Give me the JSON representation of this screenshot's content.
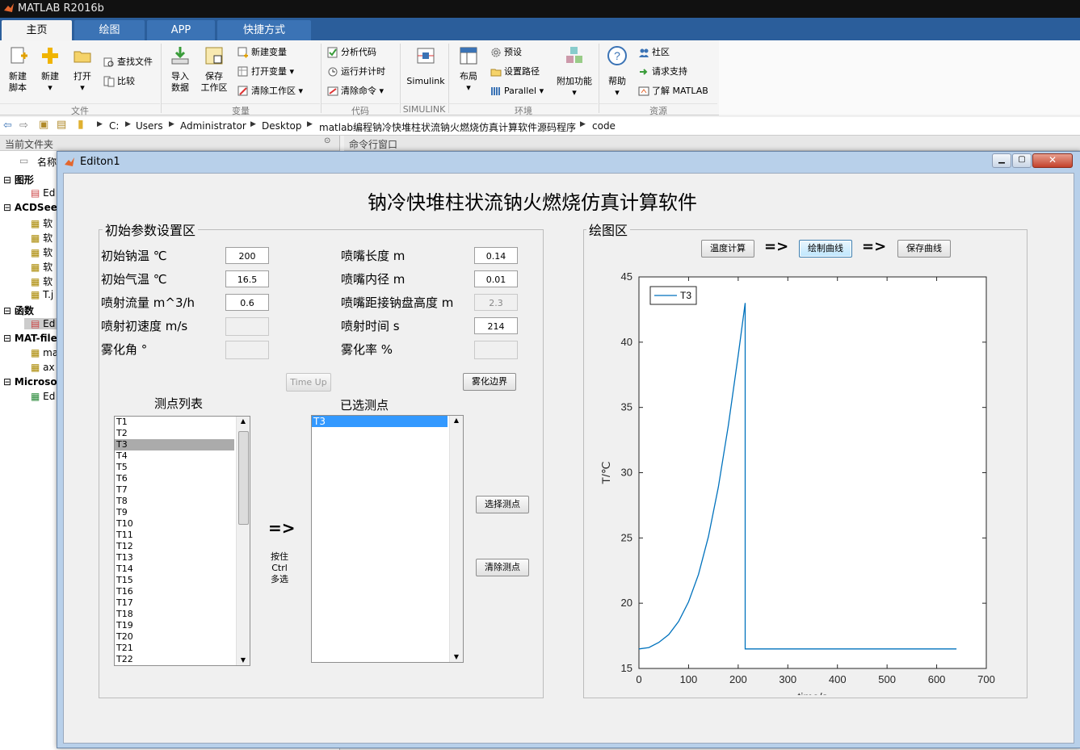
{
  "app": {
    "title": "MATLAB R2016b"
  },
  "tabs": [
    "主页",
    "绘图",
    "APP",
    "快捷方式"
  ],
  "ribbon": {
    "file": {
      "section": "文件",
      "new_script": [
        "新建",
        "脚本"
      ],
      "new": "新建",
      "open": "打开",
      "find_files": "查找文件",
      "compare": "比较"
    },
    "variable": {
      "section": "变量",
      "import": [
        "导入",
        "数据"
      ],
      "save": [
        "保存",
        "工作区"
      ],
      "new_variable": "新建变量",
      "open_variable": "打开变量",
      "clear_workspace": "清除工作区"
    },
    "code": {
      "section": "代码",
      "analyze": "分析代码",
      "run_time": "运行并计时",
      "clear_commands": "清除命令"
    },
    "simulink": {
      "section": "SIMULINK",
      "label": "Simulink"
    },
    "environment": {
      "section": "环境",
      "layout": "布局",
      "preferences": "预设",
      "set_path": "设置路径",
      "parallel": "Parallel",
      "addons": "附加功能"
    },
    "resources": {
      "section": "资源",
      "help": "帮助",
      "community": "社区",
      "support": "请求支持",
      "learn": "了解 MATLAB"
    }
  },
  "address": [
    "C:",
    "Users",
    "Administrator",
    "Desktop",
    "matlab编程钠冷快堆柱状流钠火燃烧仿真计算软件源码程序",
    "code"
  ],
  "current_folder": {
    "header": "当前文件夹",
    "name_col": "名称",
    "groups": [
      {
        "label": "图形",
        "items": [
          "Ed"
        ]
      },
      {
        "label": "ACDSee",
        "items": [
          "软",
          "软",
          "软",
          "软",
          "软",
          "T.j"
        ]
      },
      {
        "label": "函数",
        "items": [
          "Ed"
        ]
      },
      {
        "label": "MAT-file",
        "items": [
          "ma",
          "ax"
        ]
      },
      {
        "label": "Microsof",
        "items": [
          "Ed"
        ]
      }
    ]
  },
  "command_window": {
    "header": "命令行窗口"
  },
  "figure": {
    "window_title": "Editon1",
    "main_title": "钠冷快堆柱状流钠火燃烧仿真计算软件",
    "params_panel": {
      "title": "初始参数设置区",
      "left": [
        {
          "label": "初始钠温 ℃",
          "value": "200",
          "enabled": true
        },
        {
          "label": "初始气温 ℃",
          "value": "16.5",
          "enabled": true
        },
        {
          "label": "喷射流量 m^3/h",
          "value": "0.6",
          "enabled": true
        },
        {
          "label": "喷射初速度 m/s",
          "value": "",
          "enabled": false
        },
        {
          "label": "雾化角 °",
          "value": "",
          "enabled": false
        }
      ],
      "right": [
        {
          "label": "喷嘴长度 m",
          "value": "0.14",
          "enabled": true
        },
        {
          "label": "喷嘴内径 m",
          "value": "0.01",
          "enabled": true
        },
        {
          "label": "喷嘴距接钠盘高度 m",
          "value": "2.3",
          "enabled": false
        },
        {
          "label": "喷射时间 s",
          "value": "214",
          "enabled": true
        },
        {
          "label": "雾化率 %",
          "value": "",
          "enabled": false
        }
      ],
      "time_up": "Time Up",
      "atomize_boundary": "雾化边界",
      "point_list_title": "测点列表",
      "point_list": [
        "T1",
        "T2",
        "T3",
        "T4",
        "T5",
        "T6",
        "T7",
        "T8",
        "T9",
        "T10",
        "T11",
        "T12",
        "T13",
        "T14",
        "T15",
        "T16",
        "T17",
        "T18",
        "T19",
        "T20",
        "T21",
        "T22"
      ],
      "point_list_selected": "T3",
      "arrow": "=>",
      "multi_note": [
        "按住",
        "Ctrl",
        "多选"
      ],
      "selected_title": "已选测点",
      "selected_points": [
        "T3"
      ],
      "select_button": "选择测点",
      "clear_button": "清除测点"
    },
    "plot_panel": {
      "title": "绘图区",
      "temp_calc": "温度计算",
      "draw_curve": "绘制曲线",
      "save_curve": "保存曲线",
      "arrow": "=>"
    }
  },
  "chart_data": {
    "type": "line",
    "xlabel": "time/s",
    "ylabel": "T/℃",
    "xlim": [
      0,
      700
    ],
    "ylim": [
      15,
      45
    ],
    "xticks": [
      0,
      100,
      200,
      300,
      400,
      500,
      600,
      700
    ],
    "yticks": [
      15,
      20,
      25,
      30,
      35,
      40,
      45
    ],
    "legend": "top-left",
    "grid": false,
    "series": [
      {
        "name": "T3",
        "color": "#0072bd",
        "x": [
          0,
          20,
          40,
          60,
          80,
          100,
          120,
          140,
          160,
          180,
          200,
          214,
          214,
          640
        ],
        "y": [
          16.5,
          16.6,
          17.0,
          17.6,
          18.6,
          20.1,
          22.2,
          25.1,
          28.9,
          33.6,
          39.0,
          43.0,
          16.5,
          16.5
        ]
      }
    ]
  }
}
